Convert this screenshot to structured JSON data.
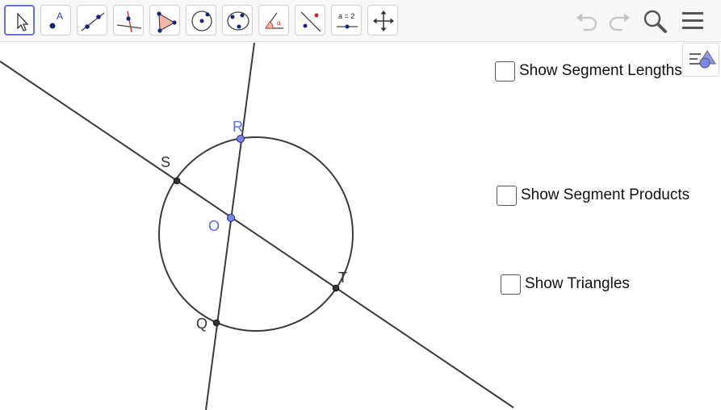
{
  "toolbar": {
    "tools": [
      {
        "icon": "move-arrow-icon",
        "active": true
      },
      {
        "icon": "point-icon",
        "label": "A"
      },
      {
        "icon": "line-through-two-points-icon"
      },
      {
        "icon": "perpendicular-line-icon"
      },
      {
        "icon": "polygon-icon"
      },
      {
        "icon": "circle-with-center-icon"
      },
      {
        "icon": "circle-through-three-points-icon"
      },
      {
        "icon": "angle-icon"
      },
      {
        "icon": "reflect-about-line-icon"
      },
      {
        "icon": "slider-icon",
        "label": "a = 2"
      },
      {
        "icon": "move-graphics-view-icon"
      }
    ],
    "right": [
      "undo-icon",
      "redo-icon",
      "search-icon",
      "menu-icon"
    ]
  },
  "canvas": {
    "points": {
      "R": "R",
      "S": "S",
      "O": "O",
      "T": "T",
      "Q": "Q"
    },
    "free_point_color": "#5b6ee1",
    "dependent_point_color": "#333333"
  },
  "checkboxes": [
    {
      "label": "Show Segment Lengths",
      "checked": false
    },
    {
      "label": "Show Segment Products",
      "checked": false
    },
    {
      "label": "Show Triangles",
      "checked": false
    }
  ]
}
